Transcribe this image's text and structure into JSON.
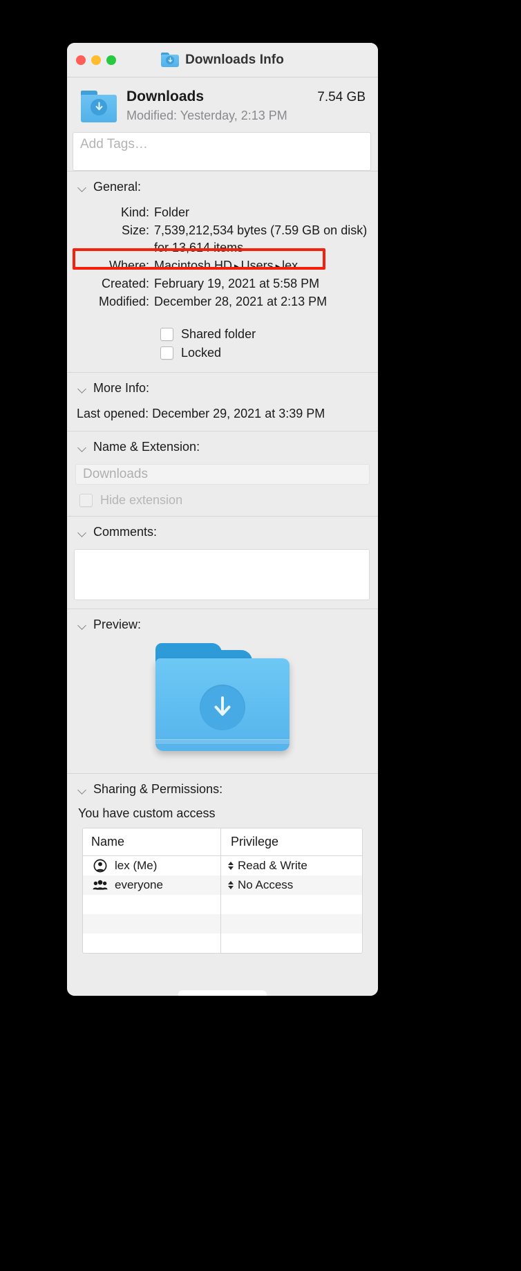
{
  "window": {
    "title": "Downloads Info",
    "title_icon": "folder-downloads-icon",
    "traffic_lights": [
      {
        "name": "close-button",
        "color": "#FF5F57"
      },
      {
        "name": "minimize-button",
        "color": "#FEBC2E"
      },
      {
        "name": "zoom-button",
        "color": "#28C840"
      }
    ]
  },
  "header": {
    "icon": "folder-downloads-icon",
    "name": "Downloads",
    "size": "7.54 GB",
    "modified_label": "Modified:",
    "modified_value": "Yesterday, 2:13 PM",
    "modified_line": "Modified: Yesterday, 2:13 PM"
  },
  "tags": {
    "placeholder": "Add Tags…"
  },
  "general": {
    "heading": "General:",
    "rows": [
      {
        "label": "Kind:",
        "value": "Folder"
      },
      {
        "label": "Size:",
        "value": "7,539,212,534 bytes (7.59 GB on disk) for 13,614 items"
      },
      {
        "label": "Where:",
        "value": "Macintosh HD ▸ Users ▸ lex",
        "highlighted": true
      },
      {
        "label": "Created:",
        "value": "February 19, 2021 at 5:58 PM"
      },
      {
        "label": "Modified:",
        "value": "December 28, 2021 at 2:13 PM"
      }
    ],
    "where_parts": {
      "p1": "Macintosh HD",
      "p2": "Users",
      "p3": "lex",
      "sep": "▸"
    },
    "checkboxes": [
      {
        "label": "Shared folder",
        "checked": false,
        "disabled": false
      },
      {
        "label": "Locked",
        "checked": false,
        "disabled": false
      }
    ]
  },
  "more_info": {
    "heading": "More Info:",
    "last_opened_label": "Last opened:",
    "last_opened_value": "December 29, 2021 at 3:39 PM",
    "last_opened_line": "Last opened: December 29, 2021 at 3:39 PM"
  },
  "name_extension": {
    "heading": "Name & Extension:",
    "name_value": "Downloads",
    "hide_extension_label": "Hide extension",
    "hide_extension_checked": false,
    "hide_extension_disabled": true
  },
  "comments": {
    "heading": "Comments:",
    "value": ""
  },
  "preview": {
    "heading": "Preview:",
    "icon": "folder-downloads-large-icon"
  },
  "sharing": {
    "heading": "Sharing & Permissions:",
    "access_note": "You have custom access",
    "columns": {
      "name": "Name",
      "privilege": "Privilege"
    },
    "rows": [
      {
        "icon": "single-user-icon",
        "name": "lex (Me)",
        "privilege": "Read & Write"
      },
      {
        "icon": "group-users-icon",
        "name": "everyone",
        "privilege": "No Access"
      },
      {
        "icon": "",
        "name": "",
        "privilege": ""
      },
      {
        "icon": "",
        "name": "",
        "privilege": ""
      },
      {
        "icon": "",
        "name": "",
        "privilege": ""
      }
    ]
  },
  "annotation": {
    "target": "Where:",
    "color": "#F4210B"
  },
  "colors": {
    "window_bg": "#ECECEC",
    "titlebar_bg": "#EDEDED",
    "folder_blue": "#60BDF0",
    "folder_tab_blue": "#2E9BD9",
    "accent_red": "#F4210B",
    "muted_text": "#8A8A8E"
  }
}
